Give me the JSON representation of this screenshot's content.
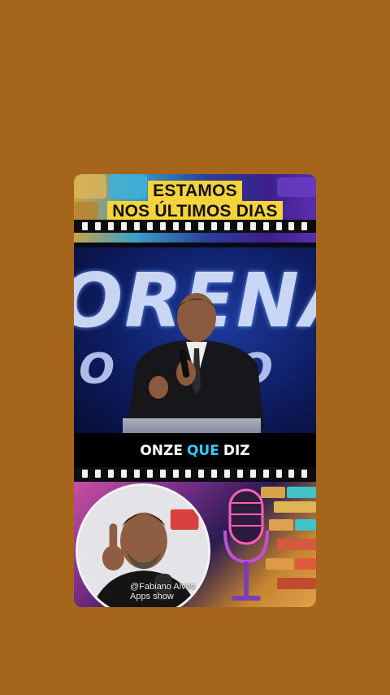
{
  "caption": {
    "line1": "ESTAMOS",
    "line2": "NOS ÚLTIMOS DIAS"
  },
  "subtitle": {
    "part1": "ONZE",
    "part2": "QUE",
    "part3": "DIZ"
  },
  "watermark": "@Fabiano Alves - Apps show",
  "colors": {
    "background": "#a5661b",
    "caption_highlight": "#f5d43b",
    "subtitle_accent": "#34c9ff"
  }
}
